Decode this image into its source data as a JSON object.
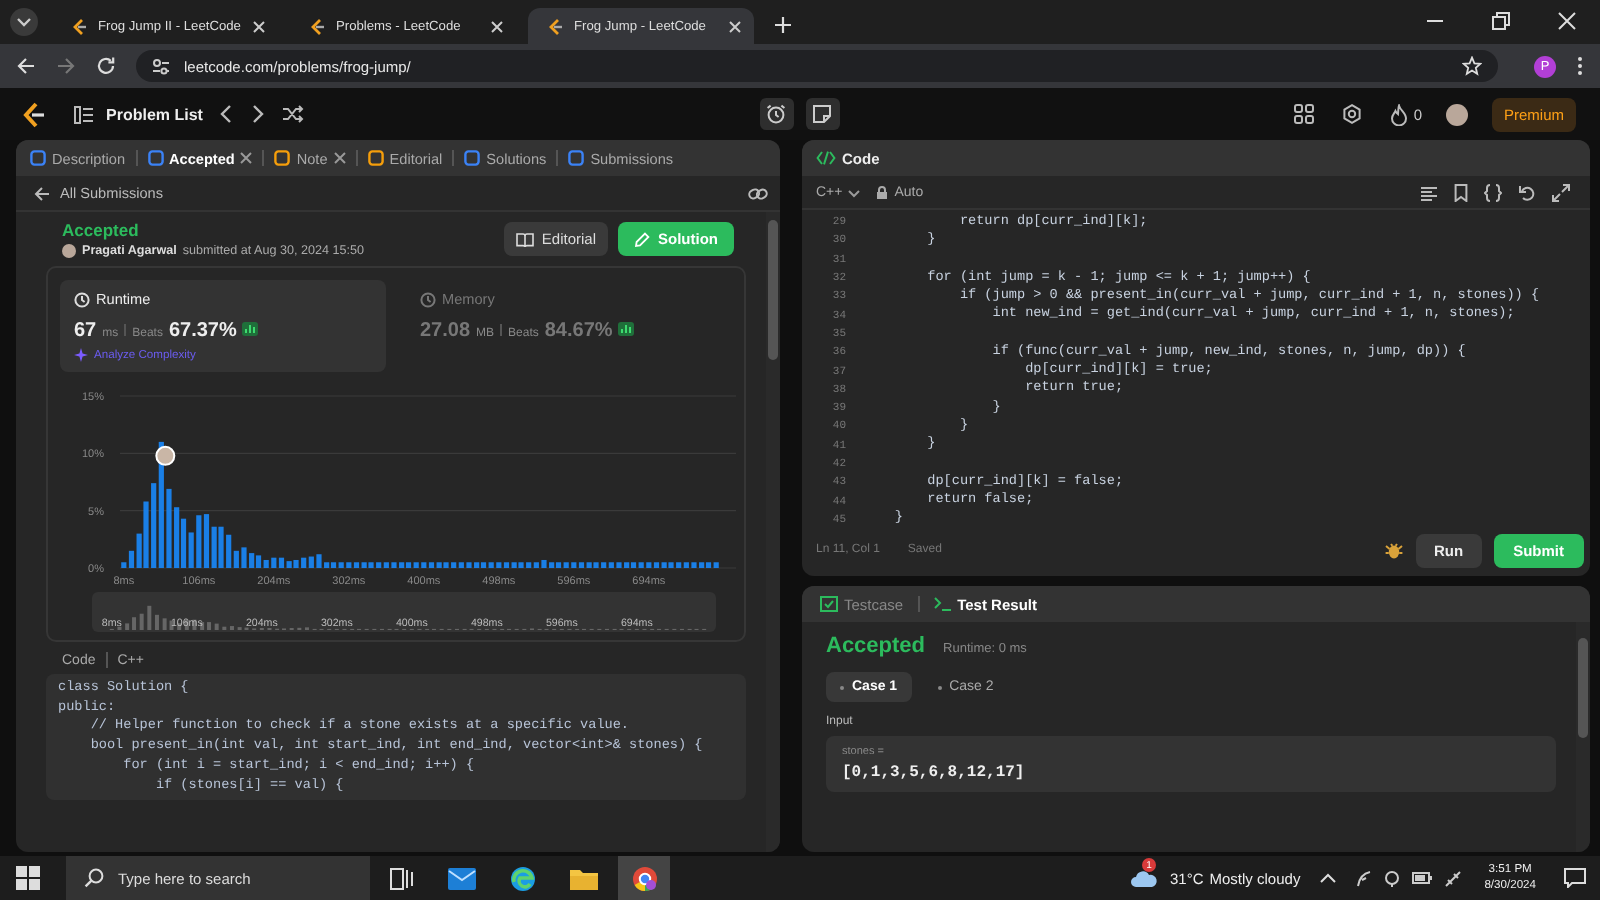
{
  "browser": {
    "tabs": [
      {
        "title": "Frog Jump II - LeetCode",
        "selected": false
      },
      {
        "title": "Problems - LeetCode",
        "selected": false
      },
      {
        "title": "Frog Jump - LeetCode",
        "selected": true
      }
    ],
    "url": "leetcode.com/problems/frog-jump/",
    "profile_initial": "P"
  },
  "nav": {
    "problem_list": "Problem List",
    "streak": "0",
    "premium": "Premium"
  },
  "left_tabs": [
    {
      "label": "Description",
      "selected": false,
      "closable": false
    },
    {
      "label": "Accepted",
      "selected": true,
      "closable": true
    },
    {
      "label": "Note",
      "selected": false,
      "closable": true
    },
    {
      "label": "Editorial",
      "selected": false,
      "closable": false
    },
    {
      "label": "Solutions",
      "selected": false,
      "closable": false
    },
    {
      "label": "Submissions",
      "selected": false,
      "closable": false
    }
  ],
  "submission": {
    "back": "All Submissions",
    "status": "Accepted",
    "author": "Pragati Agarwal",
    "submitted": "submitted at Aug 30, 2024 15:50",
    "editorial_button": "Editorial",
    "solution_button": "Solution"
  },
  "stats": [
    {
      "title": "Runtime",
      "value": "67",
      "unit": "ms",
      "beats_label": "Beats",
      "beats": "67.37%",
      "analyze": "Analyze Complexity",
      "selected": true
    },
    {
      "title": "Memory",
      "value": "27.08",
      "unit": "MB",
      "beats_label": "Beats",
      "beats": "84.67%",
      "selected": false
    }
  ],
  "chart_data": {
    "type": "bar",
    "xlim": [
      3,
      787
    ],
    "ylim": [
      0,
      15
    ],
    "yticks": [
      {
        "value": 0,
        "label": "0%"
      },
      {
        "value": 5,
        "label": "5%"
      },
      {
        "value": 10,
        "label": "10%"
      },
      {
        "value": 15,
        "label": "15%"
      }
    ],
    "xticks": [
      {
        "value": 8,
        "label": "8ms"
      },
      {
        "value": 106,
        "label": "106ms"
      },
      {
        "value": 204,
        "label": "204ms"
      },
      {
        "value": 302,
        "label": "302ms"
      },
      {
        "value": 400,
        "label": "400ms"
      },
      {
        "value": 498,
        "label": "498ms"
      },
      {
        "value": 596,
        "label": "596ms"
      },
      {
        "value": 694,
        "label": "694ms"
      }
    ],
    "x": [
      8,
      18,
      28,
      37,
      47,
      57,
      67,
      77,
      86,
      96,
      106,
      116,
      126,
      135,
      145,
      155,
      165,
      175,
      184,
      194,
      204,
      214,
      224,
      233,
      243,
      253,
      263,
      273,
      282,
      292,
      302,
      312,
      322,
      331,
      341,
      351,
      361,
      371,
      380,
      390,
      400,
      410,
      420,
      429,
      439,
      449,
      459,
      469,
      478,
      488,
      498,
      508,
      518,
      527,
      537,
      547,
      557,
      567,
      576,
      586,
      596,
      606,
      616,
      625,
      635,
      645,
      655,
      665,
      674,
      684,
      694,
      704,
      714,
      723,
      733,
      743,
      753,
      763,
      772,
      782
    ],
    "series": [
      {
        "color": "#1a7fe6",
        "values": [
          0.5,
          1.5,
          3,
          5.8,
          7.4,
          11,
          6.9,
          5.3,
          4.3,
          3.1,
          4.6,
          4.7,
          3.6,
          3.6,
          2.9,
          1.5,
          1.8,
          1.3,
          1.1,
          0.7,
          0.9,
          0.9,
          0.6,
          0.7,
          0.9,
          1.0,
          1.2,
          0.5,
          0.5,
          0.5,
          0.5,
          0.5,
          0.5,
          0.5,
          0.5,
          0.5,
          0.5,
          0.5,
          0.5,
          0.5,
          0.5,
          0.5,
          0.5,
          0.5,
          0.5,
          0.5,
          0.5,
          0.5,
          0.5,
          0.5,
          0.5,
          0.5,
          0.5,
          0.5,
          0.5,
          0.5,
          0.7,
          0.5,
          0.5,
          0.5,
          0.5,
          0.5,
          0.5,
          0.5,
          0.5,
          0.5,
          0.5,
          0.5,
          0.5,
          0.5,
          0.5,
          0.5,
          0.5,
          0.5,
          0.5,
          0.5,
          0.5,
          0.5,
          0.5,
          0.5
        ]
      }
    ]
  },
  "overview_labels": [
    "8ms",
    "106ms",
    "204ms",
    "302ms",
    "400ms",
    "498ms",
    "596ms",
    "694ms"
  ],
  "code_header": {
    "label": "Code",
    "language": "C++"
  },
  "solution_code": [
    "class Solution {",
    "public:",
    "    // Helper function to check if a stone exists at a specific value.",
    "    bool present_in(int val, int start_ind, int end_ind, vector<int>& stones) {",
    "        for (int i = start_ind; i < end_ind; i++) {",
    "            if (stones[i] == val) {"
  ],
  "editor": {
    "title": "Code",
    "language": "C++",
    "mode": "Auto",
    "lines": [
      {
        "no": "29",
        "text": "            return dp[curr_ind][k];"
      },
      {
        "no": "30",
        "text": "        }"
      },
      {
        "no": "31"
      },
      {
        "no": "32",
        "text": "        for (int jump = k - 1; jump <= k + 1; jump++) {"
      },
      {
        "no": "33",
        "text": "            if (jump > 0 && present_in(curr_val + jump, curr_ind + 1, n, stones)) {"
      },
      {
        "no": "34",
        "text": "                int new_ind = get_ind(curr_val + jump, curr_ind + 1, n, stones);"
      },
      {
        "no": "35"
      },
      {
        "no": "36",
        "text": "                if (func(curr_val + jump, new_ind, stones, n, jump, dp)) {"
      },
      {
        "no": "37",
        "text": "                    dp[curr_ind][k] = true;"
      },
      {
        "no": "38",
        "text": "                    return true;"
      },
      {
        "no": "39",
        "text": "                }"
      },
      {
        "no": "40",
        "text": "            }"
      },
      {
        "no": "41",
        "text": "        }"
      },
      {
        "no": "42"
      },
      {
        "no": "43",
        "text": "        dp[curr_ind][k] = false;"
      },
      {
        "no": "44",
        "text": "        return false;"
      },
      {
        "no": "45",
        "text": "    }"
      }
    ],
    "status": "Ln 11, Col 1",
    "saved": "Saved",
    "run": "Run",
    "submit": "Submit"
  },
  "console": {
    "tabs": [
      {
        "label": "Testcase",
        "selected": false
      },
      {
        "label": "Test Result",
        "selected": true
      }
    ],
    "status": "Accepted",
    "runtime": "Runtime: 0 ms",
    "cases": [
      {
        "label": "Case 1",
        "selected": true
      },
      {
        "label": "Case 2",
        "selected": false
      }
    ],
    "input_label": "Input",
    "param": "stones =",
    "value": "[0,1,3,5,6,8,12,17]"
  },
  "taskbar": {
    "search_placeholder": "Type here to search",
    "weather_badge": "1",
    "temperature": "31°C",
    "condition": "Mostly cloudy",
    "time": "3:51 PM",
    "date": "8/30/2024"
  }
}
